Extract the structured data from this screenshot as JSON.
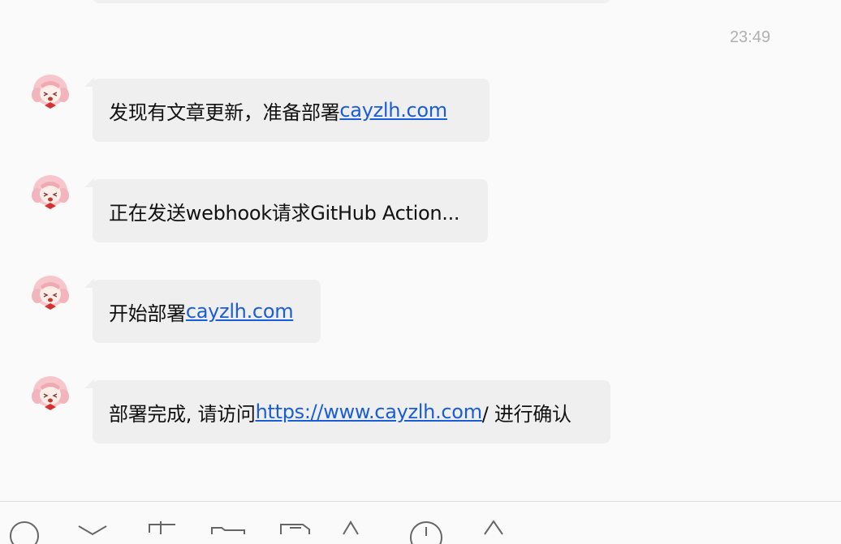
{
  "chat": {
    "timestamp": "23:49",
    "messages": [
      {
        "text": "发现有文章更新，准备部署",
        "link": "cayzlh.com",
        "suffix": ""
      },
      {
        "text": "正在发送webhook请求GitHub Action...",
        "link": "",
        "suffix": ""
      },
      {
        "text": "开始部署",
        "link": "cayzlh.com",
        "suffix": ""
      },
      {
        "text": "部署完成, 请访问 ",
        "link": "https://www.cayzlh.com",
        "suffix": "/ 进行确认"
      }
    ]
  },
  "toolbar": {
    "icons": [
      "emoji-icon",
      "scissors-icon",
      "screenshot-icon",
      "folder-icon",
      "file-icon",
      "ink-drop-icon",
      "clock-icon",
      "bell-icon"
    ]
  },
  "colors": {
    "link": "#1a5dd8",
    "bubble": "#efefef",
    "background": "#fafafa"
  }
}
